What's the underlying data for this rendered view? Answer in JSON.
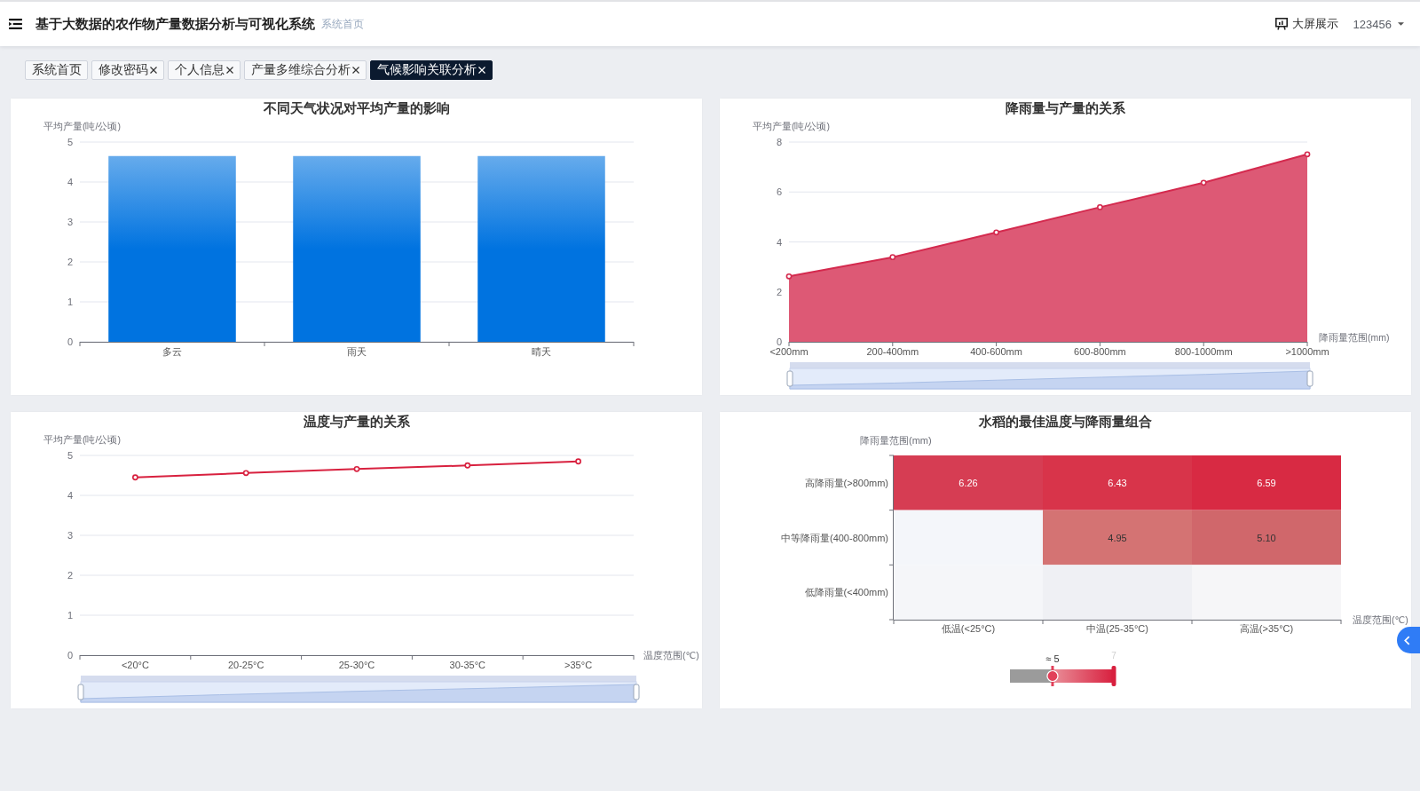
{
  "header": {
    "title": "基于大数据的农作物产量数据分析与可视化系统",
    "breadcrumb": "系统首页",
    "screen_button": "大屏展示",
    "user": "123456"
  },
  "tabs": [
    {
      "label": "系统首页",
      "closable": false,
      "selected": false
    },
    {
      "label": "修改密码",
      "closable": true,
      "selected": false
    },
    {
      "label": "个人信息",
      "closable": true,
      "selected": false
    },
    {
      "label": "产量多维综合分析",
      "closable": true,
      "selected": false
    },
    {
      "label": "气候影响关联分析",
      "closable": true,
      "selected": true
    }
  ],
  "panels": [
    {
      "kind": "chart",
      "chart_data": {
        "type": "bar",
        "title": "不同天气状况对平均产量的影响",
        "ylabel": "平均产量(吨/公顷)",
        "categories": [
          "多云",
          "雨天",
          "晴天"
        ],
        "series": [
          {
            "color": "#0073e0",
            "values": [
              4.65,
              4.65,
              4.65
            ]
          }
        ],
        "ylim": [
          0,
          5
        ],
        "yticks": [
          0,
          1,
          2,
          3,
          4,
          5
        ],
        "grid": true
      }
    },
    {
      "kind": "chart",
      "chart_data": {
        "type": "area",
        "title": "降雨量与产量的关系",
        "ylabel": "平均产量(吨/公顷)",
        "xlabel": "降雨量范围(mm)",
        "categories": [
          "<200mm",
          "200-400mm",
          "400-600mm",
          "600-800mm",
          "800-1000mm",
          ">1000mm"
        ],
        "series": [
          {
            "color": "#d42a4e",
            "marker": "circle",
            "values": [
              2.62,
              3.39,
              4.38,
              5.39,
              6.37,
              7.51
            ]
          }
        ],
        "ylim": [
          0,
          8
        ],
        "yticks": [
          0,
          2,
          4,
          6,
          8
        ],
        "grid": true
      },
      "zoom_slider": true
    },
    {
      "kind": "chart",
      "chart_data": {
        "type": "line",
        "title": "温度与产量的关系",
        "ylabel": "平均产量(吨/公顷)",
        "xlabel": "温度范围(℃)",
        "categories": [
          "<20°C",
          "20-25°C",
          "25-30°C",
          "30-35°C",
          ">35°C"
        ],
        "series": [
          {
            "color": "#d8213f",
            "marker": "circle",
            "values": [
              4.45,
              4.56,
              4.66,
              4.75,
              4.85
            ]
          }
        ],
        "ylim": [
          0,
          5
        ],
        "yticks": [
          0,
          1,
          2,
          3,
          4,
          5
        ],
        "grid": true
      },
      "zoom_slider": true
    },
    {
      "kind": "heatmap",
      "heatmap": {
        "title": "水稻的最佳温度与降雨量组合",
        "y_name": "降雨量范围(mm)",
        "rows": [
          {
            "label": "高降雨量(>800mm)",
            "cells": [
              {
                "value": "6.26",
                "color": "#d63d53"
              },
              {
                "value": "6.43",
                "color": "#d8344a"
              },
              {
                "value": "6.59",
                "color": "#d82a43"
              }
            ]
          },
          {
            "label": "中等降雨量(400-800mm)",
            "cells": [
              {
                "color": "#f4f6fa"
              },
              {
                "value": "4.95",
                "color": "#d47373"
              },
              {
                "value": "5.10",
                "color": "#d0676b"
              }
            ]
          },
          {
            "label": "低降雨量(<400mm)",
            "cells": [
              {
                "color": "#f5f6f9"
              },
              {
                "color": "#eff0f4"
              },
              {
                "color": "#f6f6f8"
              }
            ]
          }
        ],
        "x_labels": [
          "低温(<25°C)",
          "中温(25-35°C)",
          "高温(>35°C)"
        ],
        "x_name": "温度范围(℃)",
        "legend": {
          "label": "≈ 5",
          "max_label": "7",
          "level": 0.41
        }
      }
    }
  ],
  "side_button": true
}
